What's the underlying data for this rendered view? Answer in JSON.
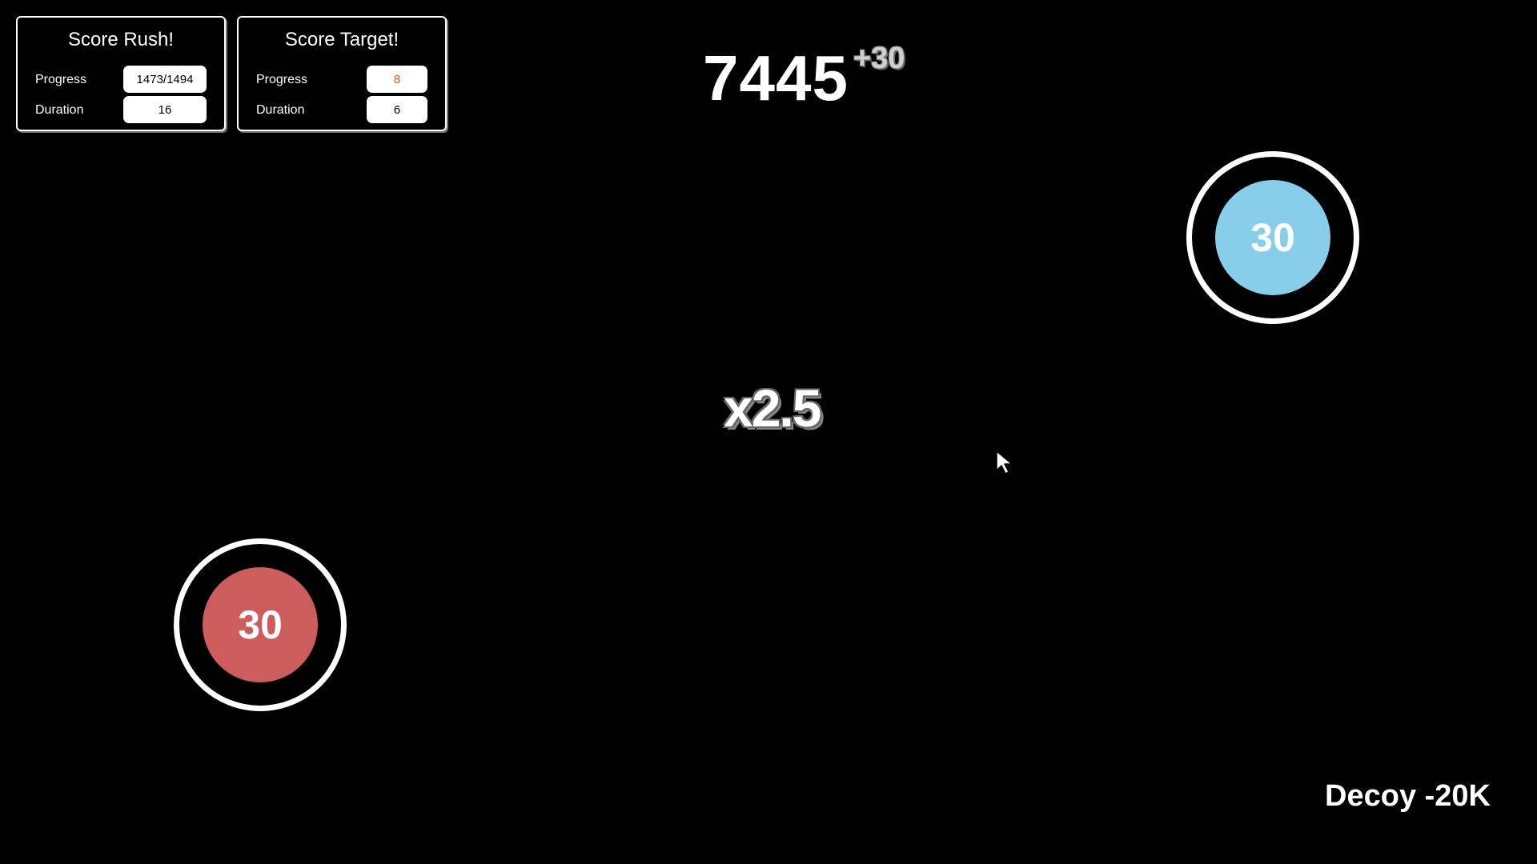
{
  "panels": {
    "rush": {
      "title": "Score Rush!",
      "progress_label": "Progress",
      "progress_value": "1473/1494",
      "duration_label": "Duration",
      "duration_value": "16"
    },
    "target": {
      "title": "Score Target!",
      "progress_label": "Progress",
      "progress_value": "8",
      "duration_label": "Duration",
      "duration_value": "6"
    }
  },
  "score": {
    "value": "7445",
    "gain": "+30"
  },
  "multiplier": "x2.5",
  "targets": [
    {
      "value": "30",
      "color": "#87ceeb"
    },
    {
      "value": "30",
      "color": "#cd5c5c"
    }
  ],
  "decoy_label": "Decoy -20K",
  "colors": {
    "background": "#000000",
    "warning_text": "#e8541c"
  }
}
